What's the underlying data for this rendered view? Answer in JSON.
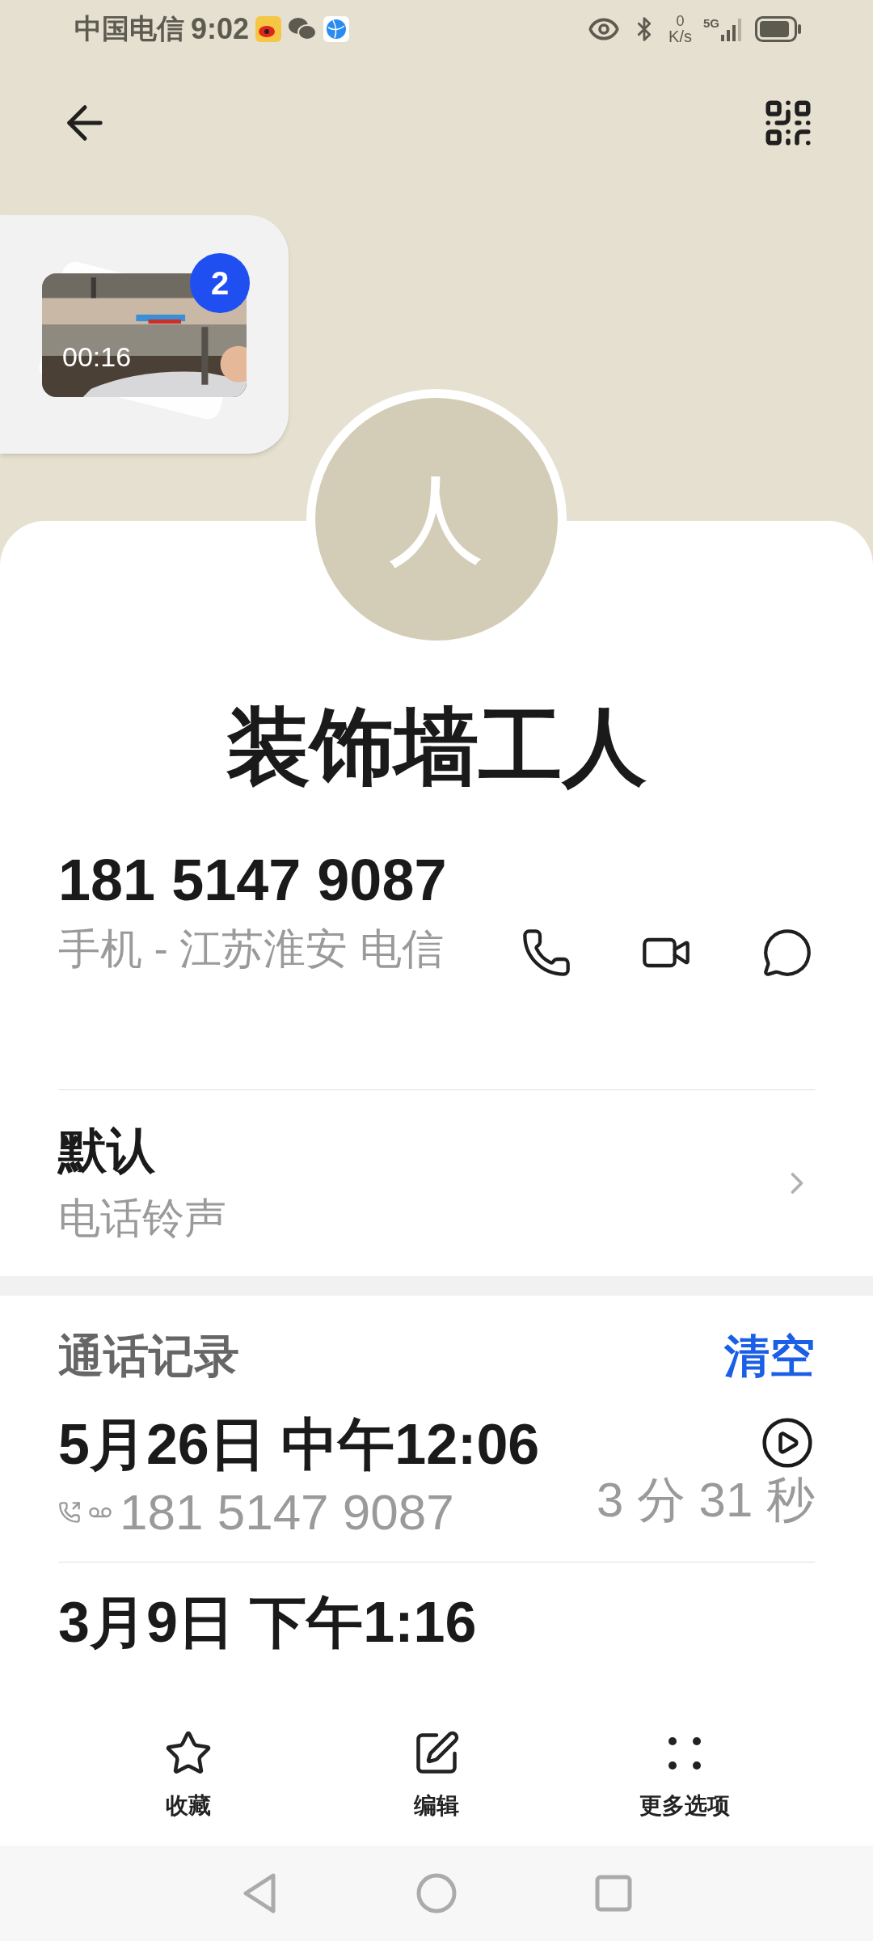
{
  "status_bar": {
    "carrier": "中国电信",
    "time": "9:02",
    "net_speed_value": "0",
    "net_speed_unit": "K/s",
    "network": "5G"
  },
  "media_card": {
    "duration": "00:16",
    "count": "2"
  },
  "contact": {
    "initial": "人",
    "name": "装饰墙工人"
  },
  "phone": {
    "number": "181 5147 9087",
    "label": "手机 - 江苏淮安 电信"
  },
  "ringtone": {
    "value": "默认",
    "label": "电话铃声"
  },
  "call_log": {
    "title": "通话记录",
    "clear": "清空",
    "entries": [
      {
        "kind": "recorded",
        "date": "5月26日 中午12:06",
        "number": "181 5147 9087",
        "duration": "3 分 31 秒"
      },
      {
        "kind": "plain",
        "date": "3月9日 下午1:16"
      }
    ]
  },
  "actions": [
    {
      "kind": "favorite",
      "label": "收藏"
    },
    {
      "kind": "edit",
      "label": "编辑"
    },
    {
      "kind": "more",
      "label": "更多选项"
    }
  ]
}
